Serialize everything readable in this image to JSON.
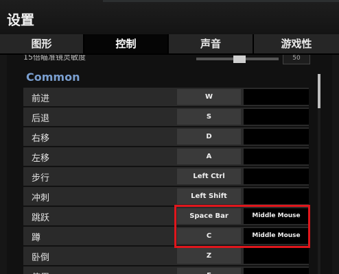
{
  "window": {
    "title": "设置"
  },
  "tabs": [
    {
      "label": "图形",
      "active": false
    },
    {
      "label": "控制",
      "active": true
    },
    {
      "label": "声音",
      "active": false
    },
    {
      "label": "游戏性",
      "active": false
    }
  ],
  "slider": {
    "label": "15倍瞄准镜灵敏度",
    "value": "50"
  },
  "section": {
    "title": "Common"
  },
  "bindings": [
    {
      "action": "前进",
      "primary": "W",
      "secondary": ""
    },
    {
      "action": "后退",
      "primary": "S",
      "secondary": ""
    },
    {
      "action": "右移",
      "primary": "D",
      "secondary": ""
    },
    {
      "action": "左移",
      "primary": "A",
      "secondary": ""
    },
    {
      "action": "步行",
      "primary": "Left Ctrl",
      "secondary": ""
    },
    {
      "action": "冲刺",
      "primary": "Left Shift",
      "secondary": ""
    },
    {
      "action": "跳跃",
      "primary": "Space Bar",
      "secondary": "Middle Mouse Button"
    },
    {
      "action": "蹲",
      "primary": "C",
      "secondary": "Middle Mouse Button"
    },
    {
      "action": "卧倒",
      "primary": "Z",
      "secondary": ""
    },
    {
      "action": "使用",
      "primary": "F",
      "secondary": ""
    }
  ],
  "colors": {
    "highlight": "#e0161c",
    "section_title": "#7a9fd0"
  }
}
